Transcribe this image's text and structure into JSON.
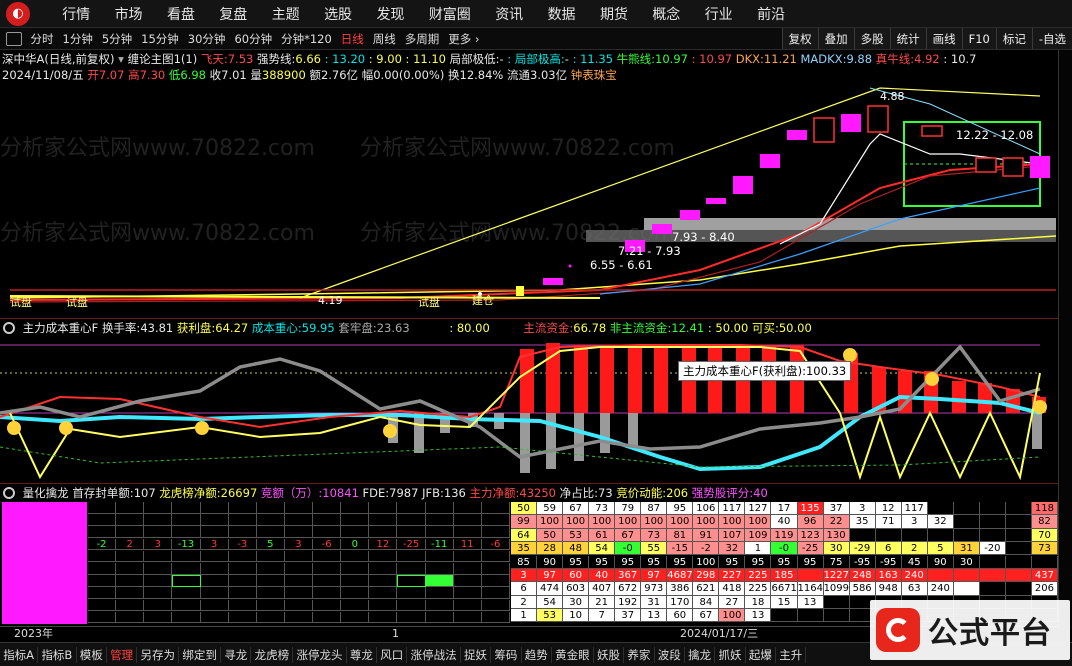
{
  "menu": [
    "行情",
    "市场",
    "看盘",
    "复盘",
    "主题",
    "选股",
    "发现",
    "财富圈",
    "资讯",
    "数据",
    "期货",
    "概念",
    "行业",
    "前沿"
  ],
  "toolbar": {
    "timeframes": [
      "分时",
      "1分钟",
      "5分钟",
      "15分钟",
      "30分钟",
      "60分钟",
      "分钟*120",
      "日线",
      "周线",
      "多周期",
      "更多 ›"
    ],
    "active_timeframe": "日线",
    "buttons": [
      "复权",
      "叠加",
      "多股",
      "统计",
      "画线",
      "F10",
      "标记",
      "-自选"
    ]
  },
  "info1": {
    "title": "深中华A(日线,前复权)",
    "indicator": "缠论主图1(1)",
    "fly_label": "飞天:",
    "fly": "7.53",
    "strong_label": "强势线:",
    "strong": "6.66",
    "v1": ": 13.20",
    "v2": ": 9.00",
    "v3": ": 11.10",
    "local_low_label": "局部极低:",
    "local_low": "-",
    "local_high_label": ": 局部极高:",
    "local_high": "-",
    "v4": ": 11.35",
    "bull_label": "牛熊线:",
    "bull": "10.97",
    "v5": ": 10.97",
    "dkx_label": "DKX:",
    "dkx": "11.21",
    "madkx_label": "MADKX:",
    "madkx": "9.88",
    "ox_label": "真牛线:",
    "ox": "4.92",
    "v6": ": 10.7"
  },
  "info2": {
    "date": "2024/11/08/五",
    "open_label": "开",
    "open": "7.07",
    "high_label": "高",
    "high": "7.30",
    "low_label": "低",
    "low": "6.98",
    "close_label": "收",
    "close": "7.01",
    "vol_label": "量",
    "vol": "388900",
    "amt_label": "额",
    "amt": "2.76亿",
    "amp_label": "幅",
    "amp": "0.00(0.00%)",
    "turn_label": "换",
    "turn": "12.84%",
    "float_label": "流通",
    "float": "3.03亿",
    "tool": "钟表珠宝"
  },
  "main_chart": {
    "labels": [
      "4.88",
      "12.22 - 12.08",
      "7.93 - 8.40",
      "7.21 - 7.93",
      "6.55 - 6.61",
      "试盘",
      "试盘",
      "建仓",
      "试盘",
      "4.19"
    ]
  },
  "ind_header": {
    "name": "主力成本重心F",
    "turn_label": "换手率:",
    "turn": "43.81",
    "profit_label": "获利盘:",
    "profit": "64.27",
    "cost_label": "成本重心:",
    "cost": "59.95",
    "set_label": "套牢盘:",
    "set": "23.63",
    "v1": ": 80.00",
    "main_fund_label": "主流资金:",
    "main_fund": "66.78",
    "non_main_label": "非主流资金:",
    "non_main": "12.41",
    "v2": ": 50.00",
    "buy_label": "可买:",
    "buy": "50.00"
  },
  "ind_tooltip": "主力成本重心F(获利盘):100.33",
  "quant_header": {
    "name": "量化擒龙",
    "first_buy_label": "首存封单额:",
    "first_buy": "107",
    "dragon_label": "龙虎榜净额:",
    "dragon": "26697",
    "bid_label": "竞额（万）:",
    "bid": "10841",
    "fde_label": "FDE:",
    "fde": "7987",
    "jfb_label": "JFB:",
    "jfb": "136",
    "main_net_label": "主力净额:",
    "main_net": "43250",
    "net_ratio_label": "净占比:",
    "net_ratio": "73",
    "bid_power_label": "竞价动能:",
    "bid_power": "206",
    "strong_score_label": "强势股评分:",
    "strong_score": "40"
  },
  "quant_left_row": [
    "-2",
    "2",
    "3",
    "-13",
    "3",
    "-3",
    "5",
    "3",
    "-6",
    "0",
    "12",
    "-25",
    "-11",
    "11",
    "-6"
  ],
  "quant_right_rows": [
    [
      "50",
      "59",
      "67",
      "73",
      "79",
      "87",
      "95",
      "106",
      "117",
      "127",
      "17",
      "135",
      "37",
      "3",
      "12",
      "117",
      "",
      "",
      "",
      "",
      "118"
    ],
    [
      "99",
      "100",
      "100",
      "100",
      "100",
      "100",
      "100",
      "100",
      "100",
      "100",
      "40",
      "96",
      "22",
      "35",
      "71",
      "3",
      "32",
      "",
      "",
      "",
      "82"
    ],
    [
      "64",
      "50",
      "53",
      "61",
      "67",
      "73",
      "81",
      "91",
      "107",
      "109",
      "119",
      "123",
      "130",
      "",
      "",
      "",
      "",
      "",
      "",
      "",
      "70"
    ],
    [
      "35",
      "28",
      "48",
      "54",
      "-0",
      "55",
      "-15",
      "-2",
      "32",
      "1",
      "-0",
      "-25",
      "30",
      "-29",
      "6",
      "2",
      "5",
      "31",
      "-20",
      "",
      "73"
    ],
    [
      "85",
      "90",
      "95",
      "95",
      "95",
      "95",
      "95",
      "100",
      "95",
      "95",
      "95",
      "95",
      "75",
      "-95",
      "-95",
      "45",
      "90",
      "30",
      "",
      "",
      ""
    ],
    [
      "3",
      "97",
      "60",
      "40",
      "367",
      "97",
      "4687",
      "298",
      "227",
      "225",
      "185",
      "",
      "1227",
      "248",
      "163",
      "240",
      "",
      "",
      "",
      "",
      "437"
    ],
    [
      "6",
      "474",
      "603",
      "407",
      "672",
      "973",
      "386",
      "621",
      "418",
      "225",
      "6671",
      "1164",
      "1099",
      "586",
      "948",
      "63",
      "240",
      "",
      "",
      "",
      "206"
    ],
    [
      "2",
      "54",
      "30",
      "21",
      "192",
      "31",
      "170",
      "84",
      "27",
      "18",
      "15",
      "13",
      "",
      "",
      "",
      "",
      "",
      "",
      "",
      "",
      ""
    ],
    [
      "1",
      "53",
      "10",
      "7",
      "37",
      "13",
      "60",
      "67",
      "100",
      "13",
      "",
      "",
      "",
      "",
      "",
      "",
      "",
      "",
      "",
      "",
      ""
    ]
  ],
  "date_axis": {
    "year": "2023年",
    "mid": "1",
    "date": "2024/01/17/三"
  },
  "tabs": [
    "指标A",
    "指标B",
    "模板",
    "管理",
    "另存为",
    "绑定到",
    "寻龙",
    "龙虎榜",
    "涨停龙头",
    "尊龙",
    "风口",
    "涨停战法",
    "捉妖",
    "筹码",
    "趋势",
    "黄金眼",
    "妖股",
    "养家",
    "波段",
    "擒龙",
    "抓妖",
    "起爆",
    "主升"
  ],
  "active_tab": "管理",
  "brand": "公式平台"
}
